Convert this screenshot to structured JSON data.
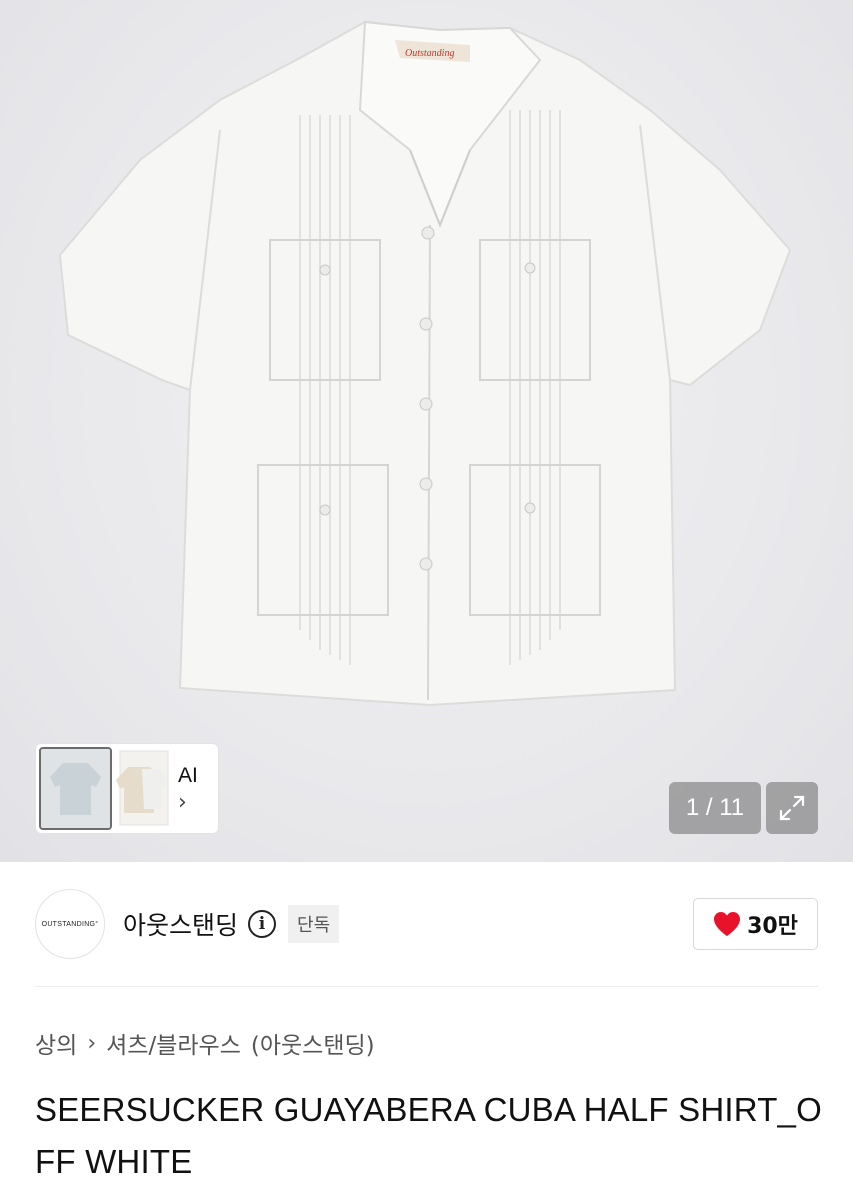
{
  "gallery": {
    "counter": "1 / 11",
    "ai_thumb_label": "AI",
    "ai_thumb_chevron": "›",
    "expand_icon": "expand-icon"
  },
  "brand": {
    "logo_text": "OUTSTANDING°",
    "name": "아웃스탠딩",
    "info_icon": "i",
    "badge": "단독",
    "like_count": "30만",
    "heart_color": "#e8132b"
  },
  "breadcrumb": {
    "category": "상의",
    "separator": "›",
    "subcategory": "셔츠/블라우스",
    "brand_paren": "(아웃스탠딩)"
  },
  "product": {
    "title": "SEERSUCKER GUAYABERA CUBA HALF SHIRT_OFF WHITE"
  }
}
